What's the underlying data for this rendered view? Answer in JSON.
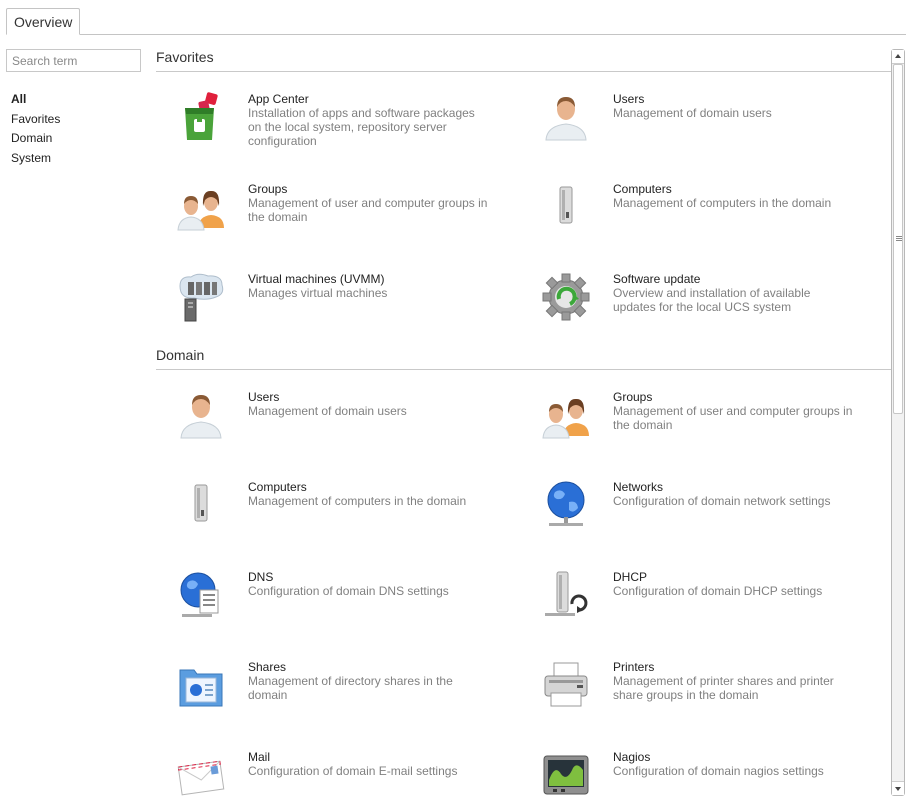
{
  "tabs": {
    "overview": "Overview"
  },
  "search": {
    "placeholder": "Search term",
    "value": ""
  },
  "categories": [
    "All",
    "Favorites",
    "Domain",
    "System"
  ],
  "sections": {
    "favorites": {
      "title": "Favorites",
      "modules": [
        {
          "name": "App Center",
          "desc": "Installation of apps and software packages on the local system, repository server configuration",
          "icon": "app-center-icon"
        },
        {
          "name": "Users",
          "desc": "Management of domain users",
          "icon": "user-icon"
        },
        {
          "name": "Groups",
          "desc": "Management of user and computer groups in the domain",
          "icon": "groups-icon"
        },
        {
          "name": "Computers",
          "desc": "Management of computers in the domain",
          "icon": "computer-icon"
        },
        {
          "name": "Virtual machines (UVMM)",
          "desc": "Manages virtual machines",
          "icon": "virtual-machines-icon"
        },
        {
          "name": "Software update",
          "desc": "Overview and installation of available updates for the local UCS system",
          "icon": "software-update-icon"
        }
      ]
    },
    "domain": {
      "title": "Domain",
      "modules": [
        {
          "name": "Users",
          "desc": "Management of domain users",
          "icon": "user-icon"
        },
        {
          "name": "Groups",
          "desc": "Management of user and computer groups in the domain",
          "icon": "groups-icon"
        },
        {
          "name": "Computers",
          "desc": "Management of computers in the domain",
          "icon": "computer-icon"
        },
        {
          "name": "Networks",
          "desc": "Configuration of domain network settings",
          "icon": "network-globe-icon"
        },
        {
          "name": "DNS",
          "desc": "Configuration of domain DNS settings",
          "icon": "dns-icon"
        },
        {
          "name": "DHCP",
          "desc": "Configuration of domain DHCP settings",
          "icon": "dhcp-icon"
        },
        {
          "name": "Shares",
          "desc": "Management of directory shares in the domain",
          "icon": "shares-folder-icon"
        },
        {
          "name": "Printers",
          "desc": "Management of printer shares and printer share groups in the domain",
          "icon": "printer-icon"
        },
        {
          "name": "Mail",
          "desc": "Configuration of domain E-mail settings",
          "icon": "mail-envelope-icon"
        },
        {
          "name": "Nagios",
          "desc": "Configuration of domain nagios settings",
          "icon": "nagios-monitor-icon"
        }
      ]
    }
  },
  "colors": {
    "description_text": "#808080",
    "rule": "#c9c9c9",
    "appcenter_green": "#4aa33a",
    "appcenter_red": "#e0203c",
    "globe_blue": "#2a6fd6"
  }
}
